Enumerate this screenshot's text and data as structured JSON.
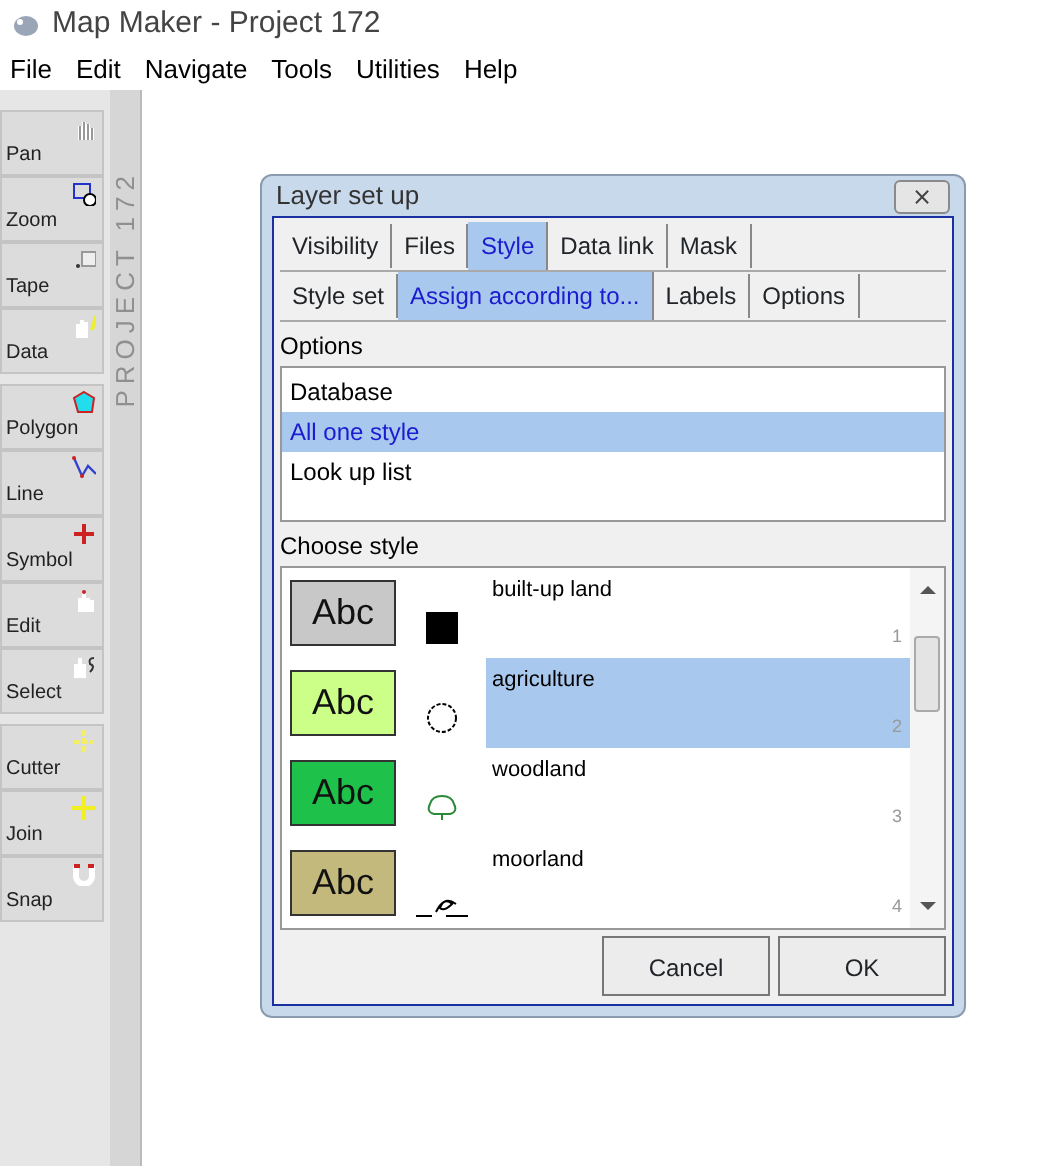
{
  "window": {
    "title": "Map Maker - Project 172"
  },
  "menu": [
    "File",
    "Edit",
    "Navigate",
    "Tools",
    "Utilities",
    "Help"
  ],
  "toolbar_groups": [
    [
      "Pan",
      "Zoom",
      "Tape",
      "Data"
    ],
    [
      "Polygon",
      "Line",
      "Symbol",
      "Edit",
      "Select"
    ],
    [
      "Cutter",
      "Join",
      "Snap"
    ]
  ],
  "side_caption": "PROJECT 172",
  "dialog": {
    "title": "Layer set up",
    "close": "⨯",
    "tabs": [
      {
        "label": "Visibility",
        "selected": false
      },
      {
        "label": "Files",
        "selected": false
      },
      {
        "label": "Style",
        "selected": true
      },
      {
        "label": "Data link",
        "selected": false
      },
      {
        "label": "Mask",
        "selected": false
      }
    ],
    "subtabs": [
      {
        "label": "Style set",
        "selected": false
      },
      {
        "label": "Assign according to...",
        "selected": true
      },
      {
        "label": "Labels",
        "selected": false
      },
      {
        "label": "Options",
        "selected": false
      }
    ],
    "options_label": "Options",
    "options": [
      {
        "label": "Database",
        "selected": false
      },
      {
        "label": "All one style",
        "selected": true
      },
      {
        "label": "Look up list",
        "selected": false
      }
    ],
    "styles_label": "Choose style",
    "styles": [
      {
        "sample": "Abc",
        "color": "#c8c8c8",
        "kind": "square",
        "name": "built-up land",
        "number": "1",
        "selected": false
      },
      {
        "sample": "Abc",
        "color": "#ccff88",
        "kind": "circle",
        "name": "agriculture",
        "number": "2",
        "selected": true
      },
      {
        "sample": "Abc",
        "color": "#1ec14a",
        "kind": "tree",
        "name": "woodland",
        "number": "3",
        "selected": false
      },
      {
        "sample": "Abc",
        "color": "#c3b97d",
        "kind": "marsh",
        "name": "moorland",
        "number": "4",
        "selected": false
      }
    ],
    "buttons": [
      "Cancel",
      "OK"
    ]
  }
}
